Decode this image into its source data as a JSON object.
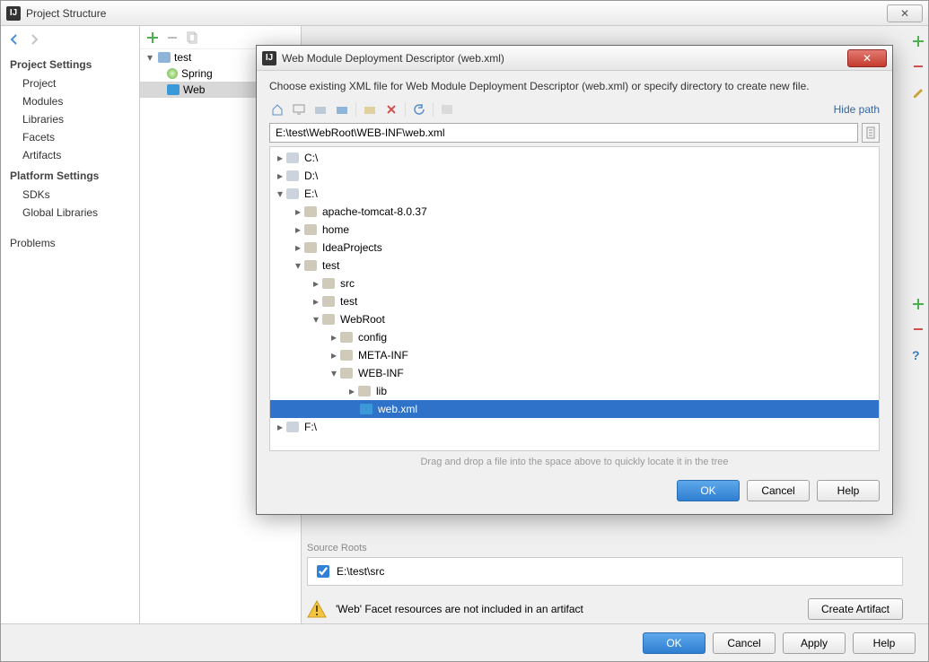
{
  "window": {
    "title": "Project Structure",
    "close_glyph": "✕"
  },
  "nav": {
    "h1": "Project Settings",
    "items1": [
      "Project",
      "Modules",
      "Libraries",
      "Facets",
      "Artifacts"
    ],
    "h2": "Platform Settings",
    "items2": [
      "SDKs",
      "Global Libraries"
    ],
    "problems": "Problems"
  },
  "tree": {
    "root": "test",
    "spring": "Spring",
    "web": "Web"
  },
  "source": {
    "label": "Source Roots",
    "path": "E:\\test\\src",
    "warning": "'Web' Facet resources are not included in an artifact",
    "create": "Create Artifact"
  },
  "buttons": {
    "ok": "OK",
    "cancel": "Cancel",
    "apply": "Apply",
    "help": "Help"
  },
  "modal": {
    "title": "Web Module Deployment Descriptor (web.xml)",
    "prompt": "Choose existing XML file for Web Module Deployment Descriptor (web.xml) or specify directory to create new file.",
    "hide": "Hide path",
    "path": "E:\\test\\WebRoot\\WEB-INF\\web.xml",
    "hint": "Drag and drop a file into the space above to quickly locate it in the tree",
    "tree": {
      "c": "C:\\",
      "d": "D:\\",
      "e": "E:\\",
      "f": "F:\\",
      "tomcat": "apache-tomcat-8.0.37",
      "home": "home",
      "ideap": "IdeaProjects",
      "test": "test",
      "src": "src",
      "test2": "test",
      "webroot": "WebRoot",
      "config": "config",
      "metainf": "META-INF",
      "webinf": "WEB-INF",
      "lib": "lib",
      "webxml": "web.xml"
    }
  }
}
